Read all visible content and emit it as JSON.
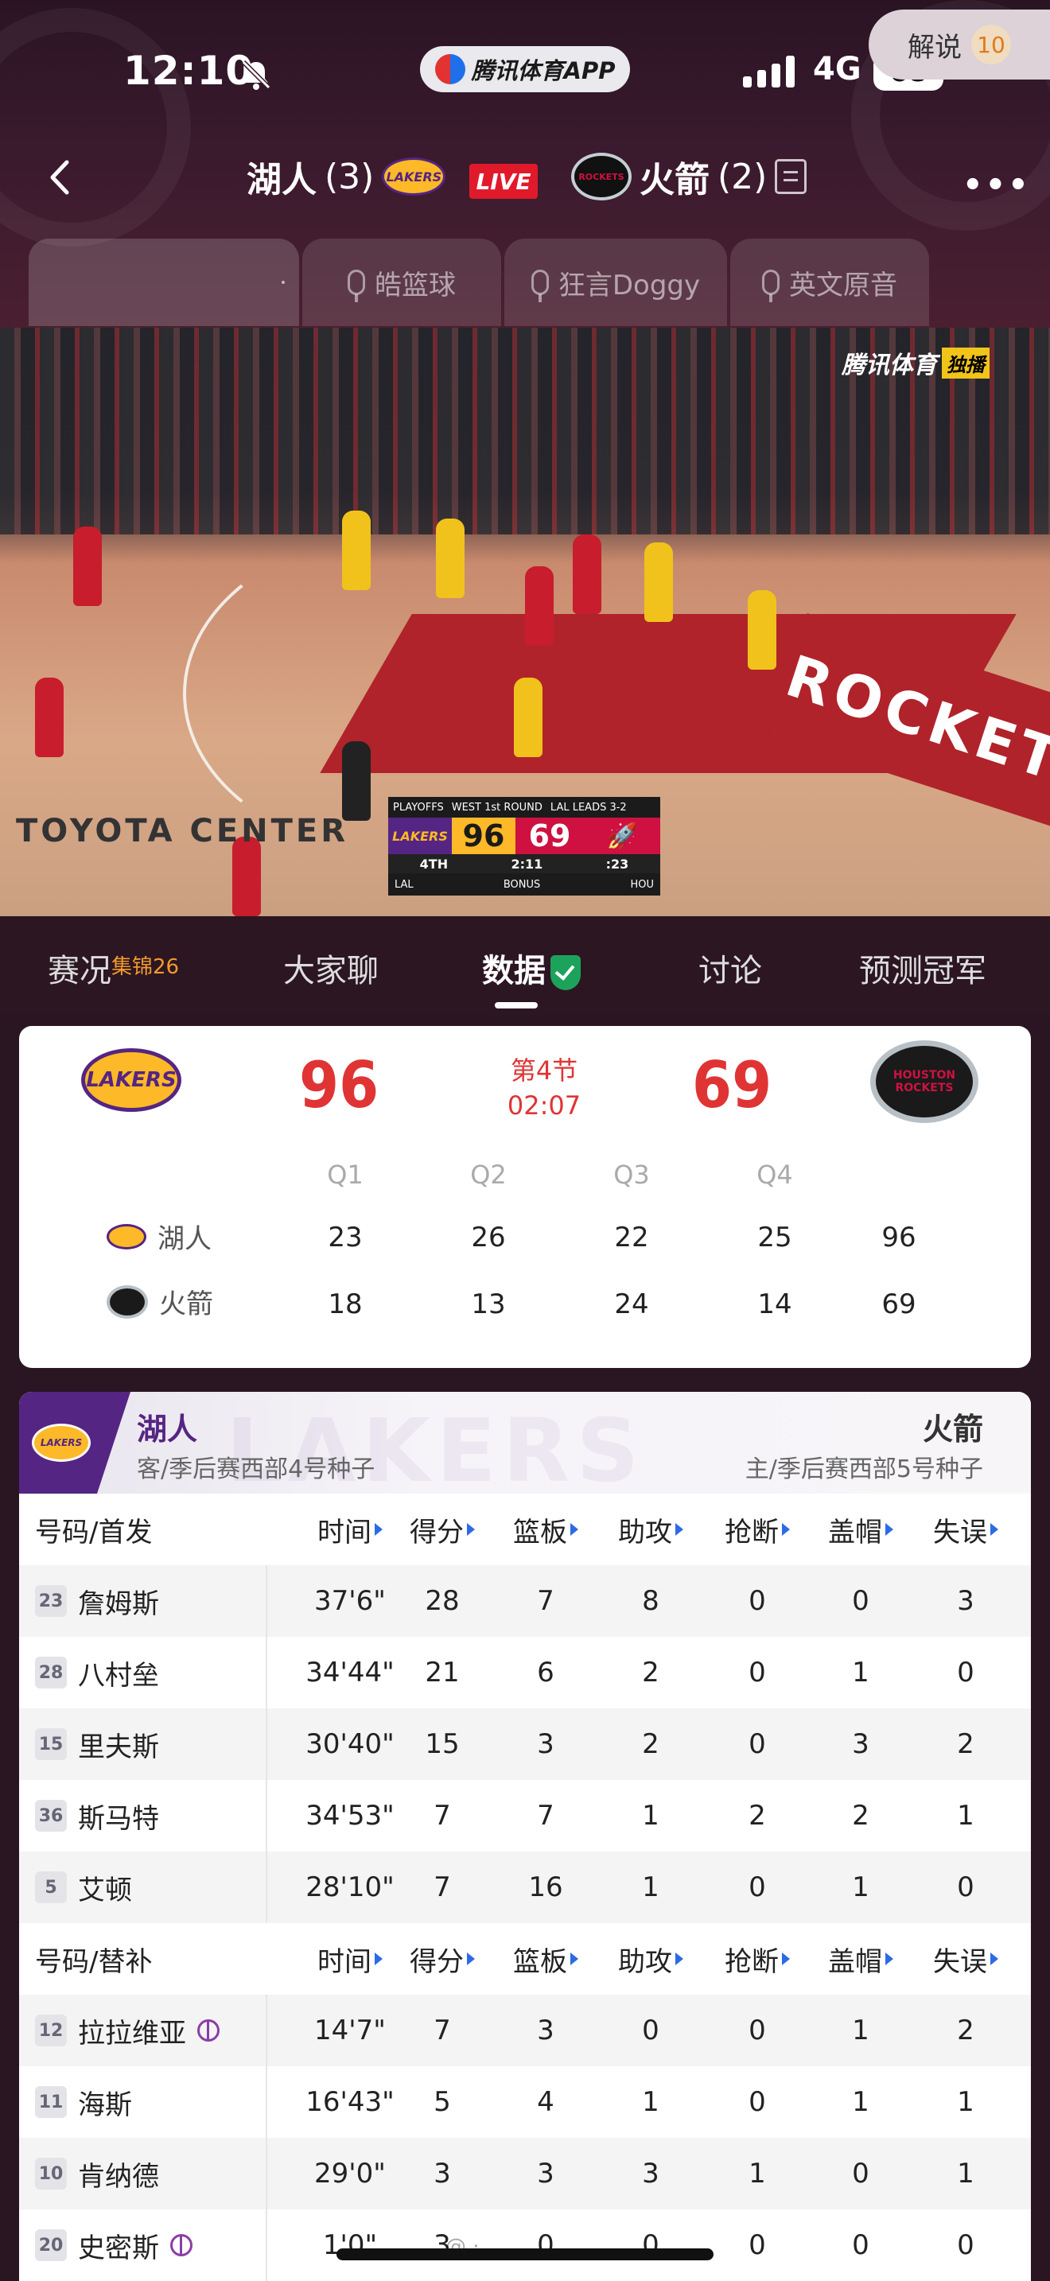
{
  "status_bar": {
    "time": "12:10",
    "app_name": "腾讯体育APP",
    "network": "4G",
    "battery": "68"
  },
  "nav": {
    "away_team": "湖人",
    "away_series": "(3)",
    "live": "LIVE",
    "home_team": "火箭",
    "home_series": "(2)"
  },
  "commentary": {
    "options": [
      "皓篮球",
      "狂言Doggy",
      "英文原音"
    ],
    "jieshuo_label": "解说",
    "jieshuo_count": "10"
  },
  "video": {
    "broadcaster": "腾讯体育",
    "exclusive": "独播",
    "scorebug": {
      "round": "WEST 1st ROUND",
      "series": "LAL LEADS 3-2",
      "quarter": "4TH",
      "clock": "2:11",
      "shot_clock": ":23",
      "away_abbr": "LAL",
      "away_score": "96",
      "home_abbr": "HOU",
      "home_score": "69",
      "bonus": "BONUS",
      "playoffs": "PLAYOFFS"
    },
    "arena_text": "TOYOTA CENTER",
    "floor_text": "ROCKETS"
  },
  "section_tabs": [
    {
      "label": "赛况",
      "sup": "集锦26"
    },
    {
      "label": "大家聊"
    },
    {
      "label": "数据"
    },
    {
      "label": "讨论"
    },
    {
      "label": "预测冠军"
    }
  ],
  "scoreboard": {
    "away_logo": "LAKERS",
    "home_logo": "HOUSTON ROCKETS",
    "away_score": "96",
    "home_score": "69",
    "period": "第4节",
    "clock": "02:07",
    "quarters": [
      "Q1",
      "Q2",
      "Q3",
      "Q4"
    ],
    "rows": [
      {
        "team": "湖人",
        "q": [
          "23",
          "26",
          "22",
          "25"
        ],
        "total": "96"
      },
      {
        "team": "火箭",
        "q": [
          "18",
          "13",
          "24",
          "14"
        ],
        "total": "69"
      }
    ]
  },
  "stats": {
    "away_name": "湖人",
    "away_sub": "客/季后赛西部4号种子",
    "home_name": "火箭",
    "home_sub": "主/季后赛西部5号种子",
    "ghost_text": "LAKERS",
    "starters_header": "号码/首发",
    "bench_header": "号码/替补",
    "columns": [
      "时间",
      "得分",
      "篮板",
      "助攻",
      "抢断",
      "盖帽",
      "失误"
    ],
    "starters": [
      {
        "num": "23",
        "name": "詹姆斯",
        "vals": [
          "37'6\"",
          "28",
          "7",
          "8",
          "0",
          "0",
          "3"
        ]
      },
      {
        "num": "28",
        "name": "八村垒",
        "vals": [
          "34'44\"",
          "21",
          "6",
          "2",
          "0",
          "1",
          "0"
        ]
      },
      {
        "num": "15",
        "name": "里夫斯",
        "vals": [
          "30'40\"",
          "15",
          "3",
          "2",
          "0",
          "3",
          "2"
        ]
      },
      {
        "num": "36",
        "name": "斯马特",
        "vals": [
          "34'53\"",
          "7",
          "7",
          "1",
          "2",
          "2",
          "1"
        ]
      },
      {
        "num": "5",
        "name": "艾顿",
        "vals": [
          "28'10\"",
          "7",
          "16",
          "1",
          "0",
          "1",
          "0"
        ]
      }
    ],
    "bench": [
      {
        "num": "12",
        "name": "拉拉维亚",
        "rookie": true,
        "vals": [
          "14'7\"",
          "7",
          "3",
          "0",
          "0",
          "1",
          "2"
        ]
      },
      {
        "num": "11",
        "name": "海斯",
        "vals": [
          "16'43\"",
          "5",
          "4",
          "1",
          "0",
          "1",
          "1"
        ]
      },
      {
        "num": "10",
        "name": "肯纳德",
        "vals": [
          "29'0\"",
          "3",
          "3",
          "3",
          "1",
          "0",
          "1"
        ]
      },
      {
        "num": "20",
        "name": "史密斯",
        "rookie": true,
        "vals": [
          "1'0\"",
          "3",
          "0",
          "0",
          "0",
          "0",
          "0"
        ]
      }
    ]
  },
  "colors": {
    "accent_red": "#e03434",
    "lakers_purple": "#552583",
    "lakers_gold": "#fdb927",
    "rockets_red": "#ce1141",
    "sort_arrow": "#2d6be4"
  }
}
